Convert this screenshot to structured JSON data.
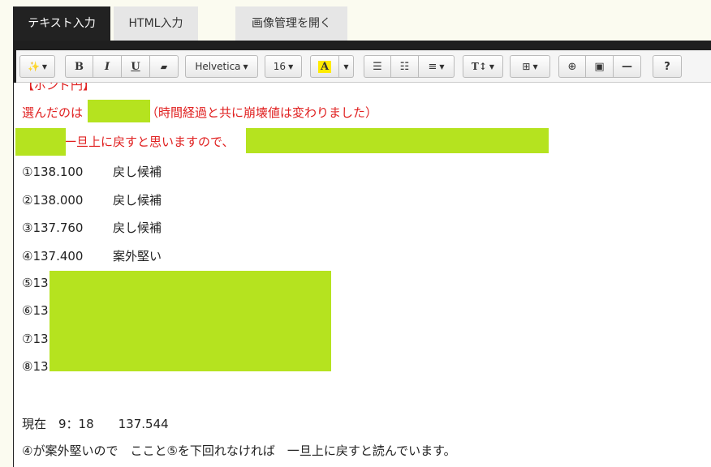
{
  "tabs": {
    "text_input": "テキスト入力",
    "html_input": "HTML入力",
    "image_manager": "画像管理を開く"
  },
  "toolbar": {
    "magic": "✨",
    "bold": "B",
    "italic": "I",
    "underline": "U",
    "eraser": "▰",
    "font_name": "Helvetica",
    "font_size": "16",
    "highlight": "A",
    "ul": "☰",
    "ol": "☷",
    "align": "≡",
    "text_size": "T↕",
    "table": "⊞",
    "link": "⊕",
    "image": "▣",
    "hr": "—",
    "help": "?"
  },
  "content": {
    "line_top": "【ポンド円】",
    "line_chosen_a": "選んだのは",
    "line_chosen_b": "（時間経過と共に崩壊値は変わりました）",
    "line_return": "一旦上に戻すと思いますので、",
    "items": [
      {
        "num": "①138.100",
        "label": "戻し候補"
      },
      {
        "num": "②138.000",
        "label": "戻し候補"
      },
      {
        "num": "③137.760",
        "label": "戻し候補"
      },
      {
        "num": "④137.400",
        "label": "案外堅い"
      }
    ],
    "hidden_items": [
      "⑤13",
      "⑥13",
      "⑦13",
      "⑧13"
    ],
    "current": "現在　9：18　　137.544",
    "summary": "④が案外堅いので　ここと⑤を下回れなければ　一旦上に戻すと読んでいます。"
  },
  "colors": {
    "mask": "#b5e31f",
    "accent_red": "#e02020"
  }
}
